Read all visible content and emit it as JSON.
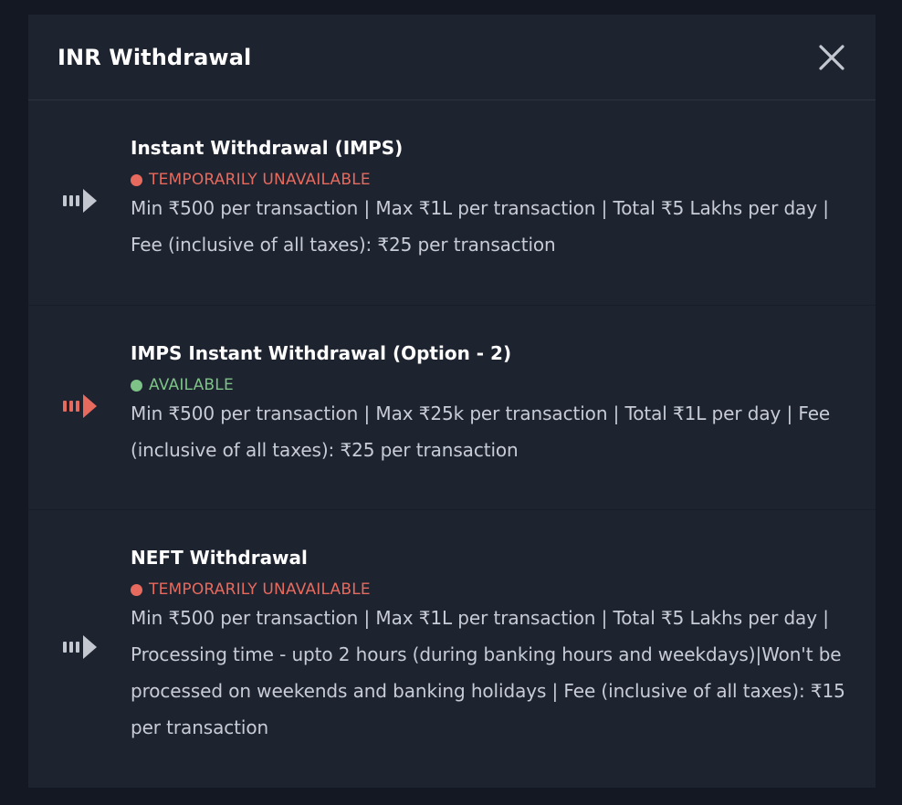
{
  "modal": {
    "title": "INR Withdrawal",
    "close_icon": "close-icon"
  },
  "colors": {
    "background": "#141823",
    "modal": "#1e2330",
    "unavailable": "#e66a5e",
    "available": "#7dc287",
    "icon_inactive": "#c3c7d0",
    "icon_active": "#e66a5e"
  },
  "options": [
    {
      "title": "Instant Withdrawal (IMPS)",
      "status": "TEMPORARILY UNAVAILABLE",
      "status_type": "unavailable",
      "description": "Min ₹500 per transaction | Max ₹1L per transaction | Total ₹5 Lakhs per day | Fee (inclusive of all taxes): ₹25 per transaction",
      "icon": "arrow-right-icon"
    },
    {
      "title": "IMPS Instant Withdrawal (Option - 2)",
      "status": "AVAILABLE",
      "status_type": "available",
      "description": "Min ₹500 per transaction | Max ₹25k per transaction | Total ₹1L per day | Fee (inclusive of all taxes): ₹25 per transaction",
      "icon": "arrow-right-icon"
    },
    {
      "title": "NEFT Withdrawal",
      "status": "TEMPORARILY UNAVAILABLE",
      "status_type": "unavailable",
      "description": "Min ₹500 per transaction | Max ₹1L per transaction | Total ₹5 Lakhs per day | Processing time - upto 2 hours (during banking hours and weekdays)|Won't be processed on weekends and banking holidays | Fee (inclusive of all taxes): ₹15 per transaction",
      "icon": "arrow-right-icon"
    }
  ]
}
